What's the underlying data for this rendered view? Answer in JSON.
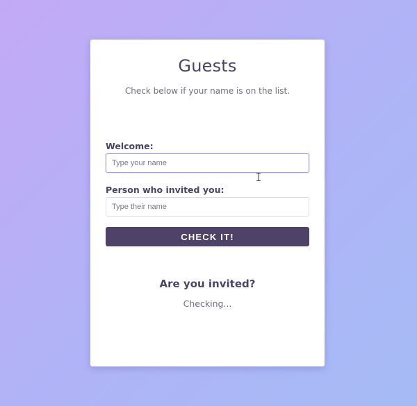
{
  "card": {
    "title": "Guests",
    "subtitle": "Check below if your name is on the list."
  },
  "form": {
    "welcome_label": "Welcome:",
    "welcome_input": {
      "value": "",
      "placeholder": "Type your name"
    },
    "inviter_label": "Person who invited you:",
    "inviter_input": {
      "value": "",
      "placeholder": "Type their name"
    },
    "submit_label": "CHECK IT!"
  },
  "result": {
    "title": "Are you invited?",
    "status": "Checking..."
  },
  "cursor": {
    "icon": "text-cursor-icon"
  },
  "colors": {
    "accent": "#4f4268",
    "heading": "#4b4468",
    "muted": "#6f6f80",
    "focus_border": "#a99ce0"
  }
}
